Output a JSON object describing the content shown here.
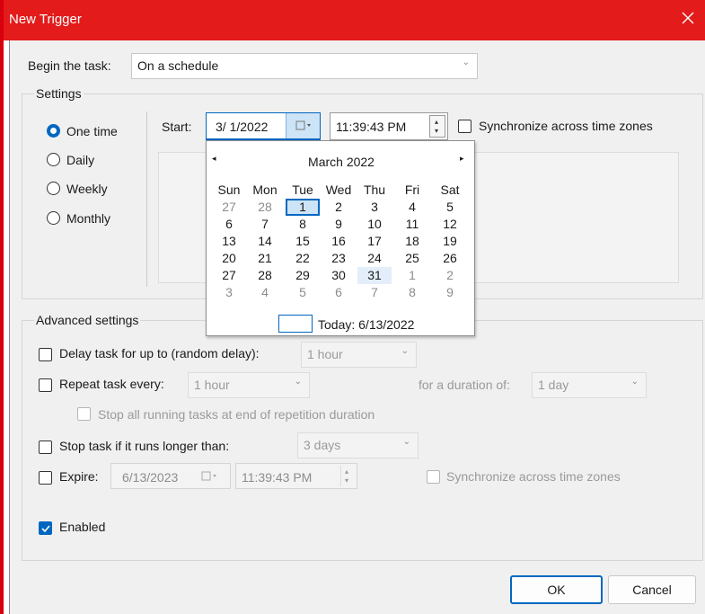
{
  "window": {
    "title": "New Trigger"
  },
  "begin_task": {
    "label": "Begin the task:",
    "value": "On a schedule"
  },
  "settings": {
    "group_label": "Settings",
    "radios": [
      {
        "label": "One time",
        "selected": true
      },
      {
        "label": "Daily",
        "selected": false
      },
      {
        "label": "Weekly",
        "selected": false
      },
      {
        "label": "Monthly",
        "selected": false
      }
    ],
    "start_label": "Start:",
    "start_date": "3/ 1/2022",
    "start_time": "11:39:43 PM",
    "sync_label": "Synchronize across time zones"
  },
  "calendar": {
    "month_title": "March 2022",
    "weekdays": [
      "Sun",
      "Mon",
      "Tue",
      "Wed",
      "Thu",
      "Fri",
      "Sat"
    ],
    "weeks": [
      [
        "27",
        "28",
        "1",
        "2",
        "3",
        "4",
        "5"
      ],
      [
        "6",
        "7",
        "8",
        "9",
        "10",
        "11",
        "12"
      ],
      [
        "13",
        "14",
        "15",
        "16",
        "17",
        "18",
        "19"
      ],
      [
        "20",
        "21",
        "22",
        "23",
        "24",
        "25",
        "26"
      ],
      [
        "27",
        "28",
        "29",
        "30",
        "31",
        "1",
        "2"
      ],
      [
        "3",
        "4",
        "5",
        "6",
        "7",
        "8",
        "9"
      ]
    ],
    "today_label": "Today: 6/13/2022",
    "selected_day": "1",
    "highlighted_day": "31"
  },
  "advanced": {
    "group_label": "Advanced settings",
    "delay": {
      "label": "Delay task for up to (random delay):",
      "value": "1 hour"
    },
    "repeat": {
      "label": "Repeat task every:",
      "value": "1 hour",
      "duration_label": "for a duration of:",
      "duration_value": "1 day"
    },
    "stop_running": {
      "label": "Stop all running tasks at end of repetition duration"
    },
    "stop_longer": {
      "label": "Stop task if it runs longer than:",
      "value": "3 days"
    },
    "expire": {
      "label": "Expire:",
      "date": "6/13/2023",
      "time": "11:39:43 PM",
      "sync_label": "Synchronize across time zones"
    },
    "enabled": {
      "label": "Enabled",
      "checked": true
    }
  },
  "buttons": {
    "ok": "OK",
    "cancel": "Cancel"
  },
  "colors": {
    "titlebar": "#e31b1b",
    "accent": "#0067c0"
  }
}
